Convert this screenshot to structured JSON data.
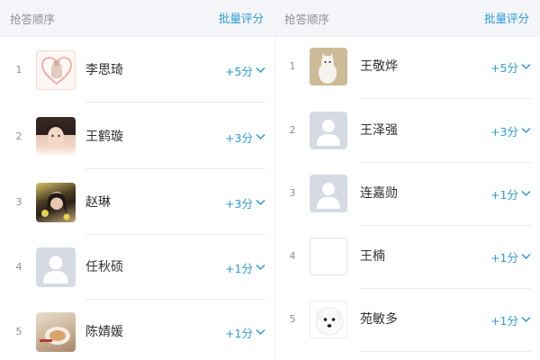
{
  "left": {
    "header": {
      "title": "抢答顺序",
      "batch": "批量评分"
    },
    "rows": [
      {
        "rank": "1",
        "name": "李思琦",
        "score": "+5分",
        "avatar": "heart-avatar"
      },
      {
        "rank": "2",
        "name": "王鹤璇",
        "score": "+3分",
        "avatar": "photo-avatar"
      },
      {
        "rank": "3",
        "name": "赵琳",
        "score": "+3分",
        "avatar": "photo-avatar"
      },
      {
        "rank": "4",
        "name": "任秋硕",
        "score": "+1分",
        "avatar": "default-avatar"
      },
      {
        "rank": "5",
        "name": "陈婧媛",
        "score": "+1分",
        "avatar": "photo-avatar"
      }
    ]
  },
  "right": {
    "header": {
      "title": "抢答顺序",
      "batch": "批量评分"
    },
    "rows": [
      {
        "rank": "1",
        "name": "王敬烨",
        "score": "+5分",
        "avatar": "photo-avatar"
      },
      {
        "rank": "2",
        "name": "王泽强",
        "score": "+3分",
        "avatar": "default-avatar"
      },
      {
        "rank": "3",
        "name": "连嘉勋",
        "score": "+1分",
        "avatar": "default-avatar"
      },
      {
        "rank": "4",
        "name": "王楠",
        "score": "+1分",
        "avatar": "blank-avatar"
      },
      {
        "rank": "5",
        "name": "苑敏多",
        "score": "+1分",
        "avatar": "dog-avatar"
      }
    ]
  },
  "colors": {
    "accent": "#2b9bd6",
    "header_bg": "#f4f5f8",
    "default_avatar": "#d5dae3"
  },
  "icons": {
    "score_toggle": "chevron-down-icon"
  }
}
